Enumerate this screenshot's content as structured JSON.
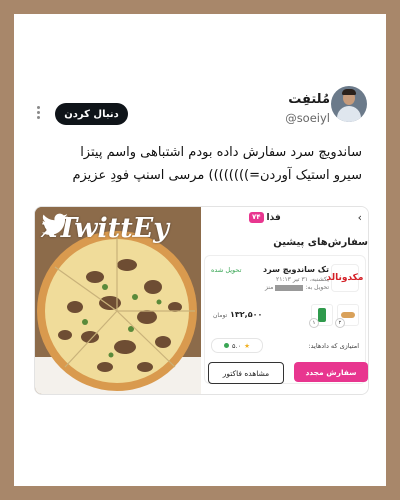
{
  "tweet": {
    "display_name": "مُلتفِت",
    "handle": "@soeiyl",
    "follow_label": "دنبال کردن",
    "text_line1": "ساندویچ سرد سفارش داده بودم اشتباهی واسم پیتزا",
    "text_line2": "سیرو استیک آوردن=)))))))) مرسی اسنپ فودِ عزیزم"
  },
  "media": {
    "watermark": "xTwittEy",
    "app": {
      "back_arrow": "›",
      "title": "فذا",
      "badge": "۷۴",
      "section_title": "سفارش‌های پیشین",
      "order": {
        "restaurant_logo_text": "مکدونالد",
        "restaurant_name": "تک ساندویچ سرد",
        "date_text": "یکشنبه، ۳۱ تیر ۲۱:۱۳",
        "address_label": "تحویل به:",
        "address_value": "منز",
        "status": "تحویل شده",
        "items": [
          {
            "type": "sandwich",
            "qty": "۲"
          },
          {
            "type": "can",
            "qty": "۱"
          }
        ],
        "price_value": "۱۳۲,۵۰۰",
        "price_unit": "تومان",
        "rating_label": "امتیازی که دادهاید:",
        "rating_value": "۵.۰"
      },
      "reorder_label": "سفارش مجدد",
      "invoice_label": "مشاهده فاکتور"
    }
  },
  "colors": {
    "frame": "#a8876a",
    "accent_pink": "#e8368f",
    "delivered_green": "#3aa655"
  }
}
